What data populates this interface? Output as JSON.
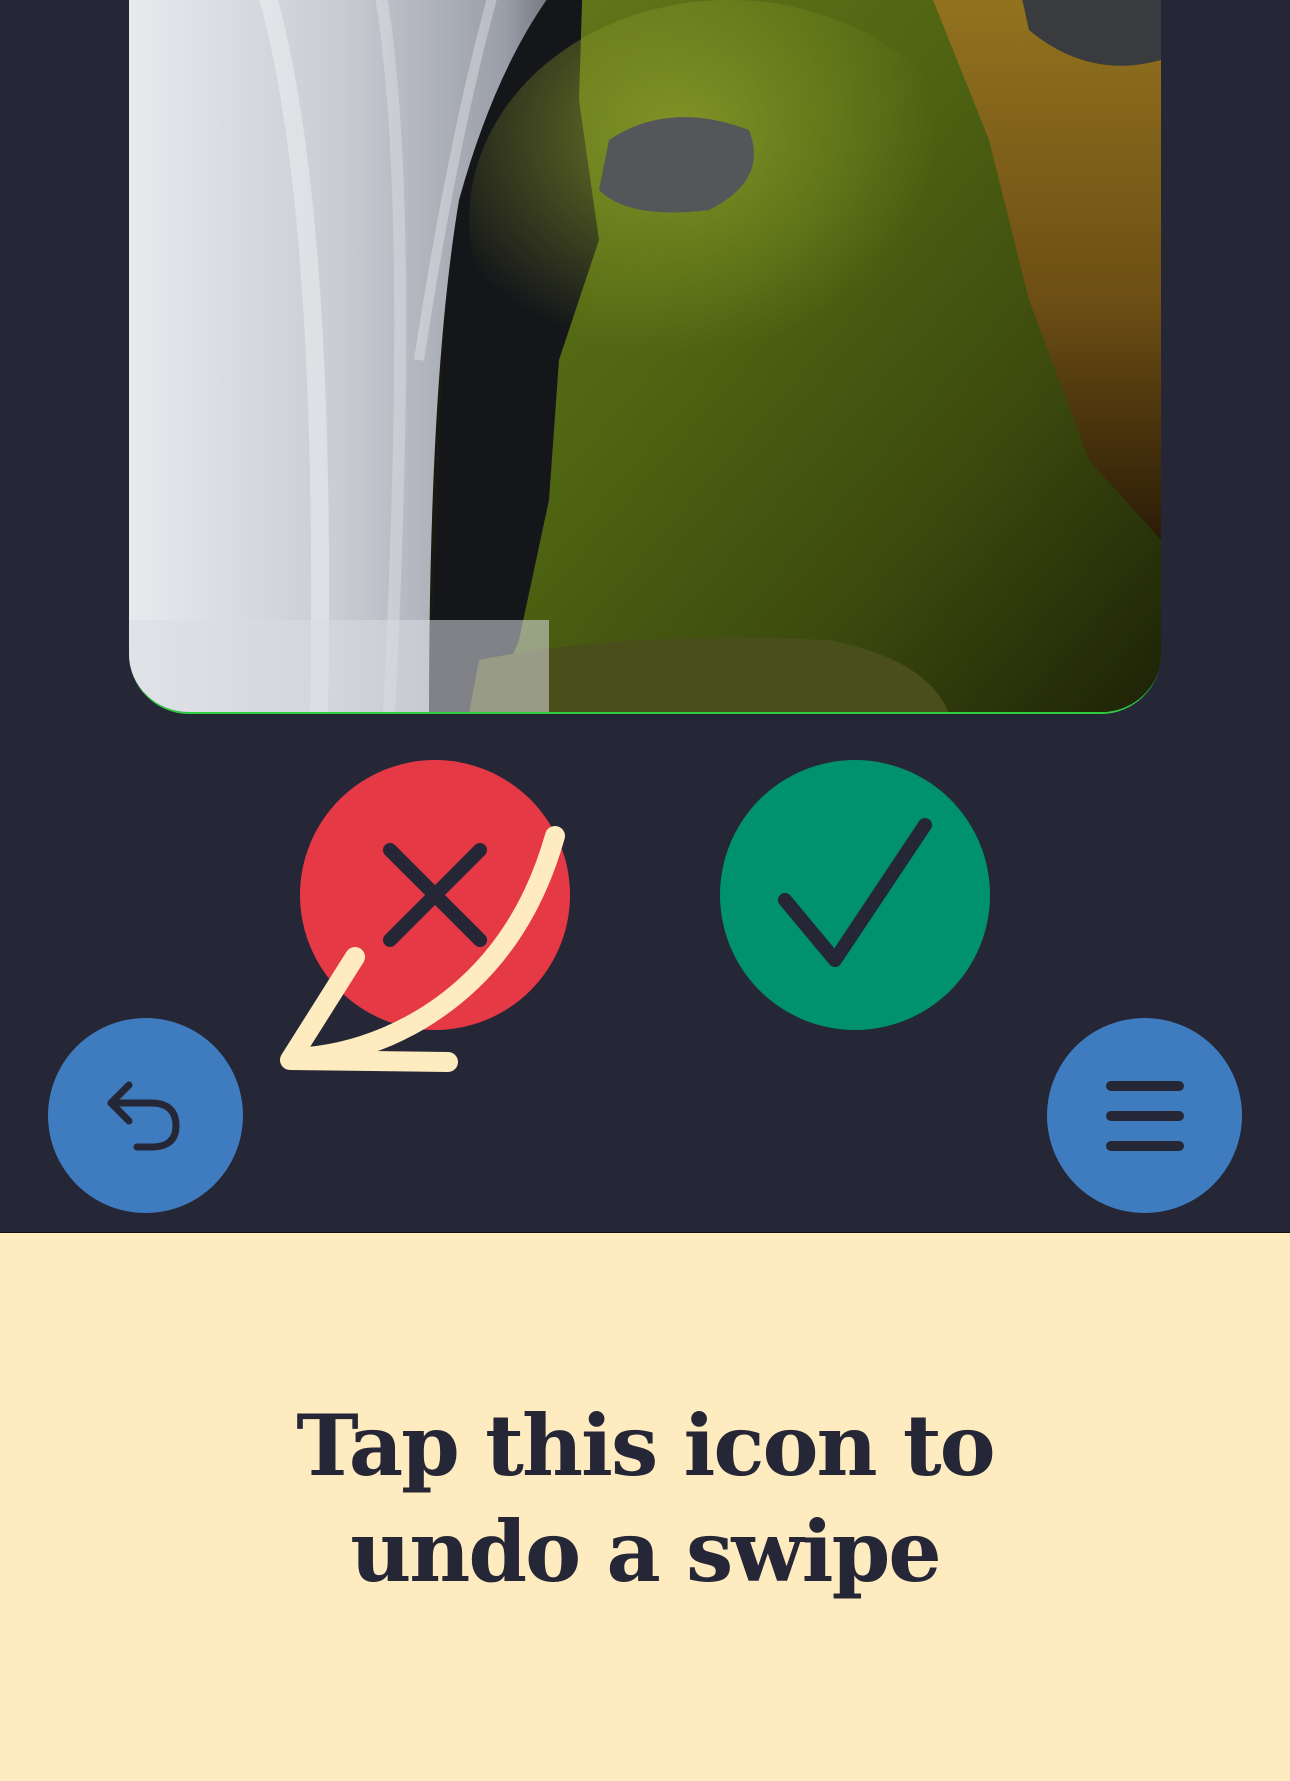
{
  "photo": {
    "subject": "waterfall-with-mossy-rock"
  },
  "buttons": {
    "reject": {
      "icon": "close-icon",
      "color": "#e63946"
    },
    "accept": {
      "icon": "checkmark-icon",
      "color": "#00916e"
    },
    "undo": {
      "icon": "undo-icon",
      "color": "#3f7cbf"
    },
    "menu": {
      "icon": "menu-icon",
      "color": "#3f7cbf"
    }
  },
  "tutorial": {
    "arrow_icon": "pointer-arrow-icon",
    "arrow_color": "#feebc0",
    "message": "Tap this icon to undo a swipe",
    "panel_color": "#feebc0"
  },
  "theme": {
    "background": "#252636",
    "text": "#252636"
  }
}
